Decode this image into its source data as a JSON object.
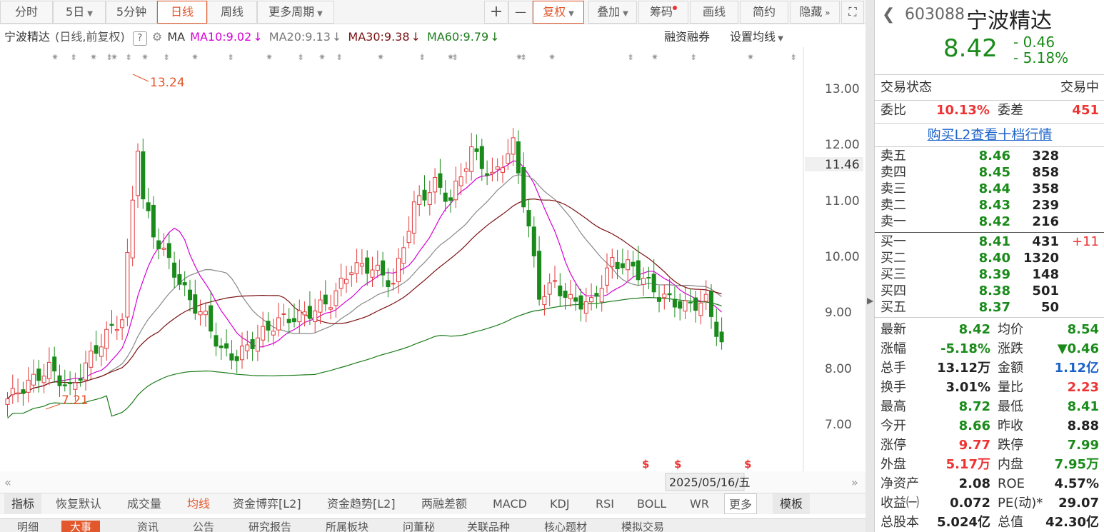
{
  "toolbar": {
    "t1": "分时",
    "t2": "5日",
    "t3": "5分钟",
    "t4": "日线",
    "t5": "周线",
    "t6": "更多周期",
    "plus": "+",
    "minus": "—",
    "fq": "复权",
    "add": "叠加",
    "chip": "筹码",
    "draw": "画线",
    "simple": "简约",
    "hide": "隐藏"
  },
  "legend": {
    "name": "宁波精达",
    "mode": "(日线,前复权)",
    "ma": "MA",
    "ma10": "MA10:9.02",
    "ma20": "MA20:9.13",
    "ma30": "MA30:9.38",
    "ma60": "MA60:9.79",
    "margin": "融资融券",
    "setma": "设置均线"
  },
  "axis": {
    "y1": "13.00",
    "y2": "12.00",
    "y3": "11.46",
    "y4": "11.00",
    "y5": "10.00",
    "y6": "9.00",
    "y7": "8.00",
    "y8": "7.00",
    "date": "2025/05/16/五",
    "hi": "13.24",
    "lo": "7.21"
  },
  "colors": {
    "up": "#e33a3a",
    "down": "#1a8b1a",
    "ma10": "#d400d4",
    "ma20": "#888888",
    "ma30": "#7a1010",
    "ma60": "#1a7a1a"
  },
  "indicators": {
    "i1": "指标",
    "i2": "恢复默认",
    "i3": "成交量",
    "i4": "均线",
    "i5": "资金博弈[L2]",
    "i6": "资金趋势[L2]",
    "i7": "两融差额",
    "i8": "MACD",
    "i9": "KDJ",
    "i10": "RSI",
    "i11": "BOLL",
    "i12": "WR",
    "i13": "更多",
    "i14": "模板"
  },
  "news": {
    "n1": "明细",
    "n2": "大事",
    "n3": "资讯",
    "n4": "公告",
    "n5": "研究报告",
    "n6": "所属板块",
    "n7": "问董秘",
    "n8": "关联品种",
    "n9": "核心题材",
    "n10": "模拟交易"
  },
  "stock": {
    "code": "603088",
    "name": "宁波精达",
    "price": "8.42",
    "chg": "- 0.46",
    "pct": "- 5.18%",
    "state_k": "交易状态",
    "state_v": "交易中",
    "wb_k": "委比",
    "wb_v": "10.13%",
    "wc_k": "委差",
    "wc_v": "451",
    "l2": "购买L2查看十档行情"
  },
  "orderbook": {
    "asks": [
      {
        "n": "卖五",
        "p": "8.46",
        "v": "328"
      },
      {
        "n": "卖四",
        "p": "8.45",
        "v": "858"
      },
      {
        "n": "卖三",
        "p": "8.44",
        "v": "358"
      },
      {
        "n": "卖二",
        "p": "8.43",
        "v": "239"
      },
      {
        "n": "卖一",
        "p": "8.42",
        "v": "216"
      }
    ],
    "bids": [
      {
        "n": "买一",
        "p": "8.41",
        "v": "431",
        "e": "+11"
      },
      {
        "n": "买二",
        "p": "8.40",
        "v": "1320",
        "e": ""
      },
      {
        "n": "买三",
        "p": "8.39",
        "v": "148",
        "e": ""
      },
      {
        "n": "买四",
        "p": "8.38",
        "v": "501",
        "e": ""
      },
      {
        "n": "买五",
        "p": "8.37",
        "v": "50",
        "e": ""
      }
    ]
  },
  "stats": [
    {
      "k1": "最新",
      "v1": "8.42",
      "c1": "g",
      "k2": "均价",
      "v2": "8.54",
      "c2": "g"
    },
    {
      "k1": "涨幅",
      "v1": "-5.18%",
      "c1": "g",
      "k2": "涨跌",
      "v2": "▼0.46",
      "c2": "g"
    },
    {
      "k1": "总手",
      "v1": "13.12万",
      "c1": "blk",
      "k2": "金额",
      "v2": "1.12亿",
      "c2": "b"
    },
    {
      "k1": "换手",
      "v1": "3.01%",
      "c1": "blk",
      "k2": "量比",
      "v2": "2.23",
      "c2": "r"
    },
    {
      "k1": "最高",
      "v1": "8.72",
      "c1": "g",
      "k2": "最低",
      "v2": "8.41",
      "c2": "g"
    },
    {
      "k1": "今开",
      "v1": "8.66",
      "c1": "g",
      "k2": "昨收",
      "v2": "8.88",
      "c2": "blk"
    },
    {
      "k1": "涨停",
      "v1": "9.77",
      "c1": "r",
      "k2": "跌停",
      "v2": "7.99",
      "c2": "g"
    },
    {
      "k1": "外盘",
      "v1": "5.17万",
      "c1": "r",
      "k2": "内盘",
      "v2": "7.95万",
      "c2": "g"
    },
    {
      "k1": "净资产",
      "v1": "2.08",
      "c1": "blk",
      "k2": "ROE",
      "v2": "4.57%",
      "c2": "blk"
    },
    {
      "k1": "收益㈠",
      "v1": "0.072",
      "c1": "blk",
      "k2": "PE(动)*",
      "v2": "29.07",
      "c2": "blk"
    },
    {
      "k1": "总股本",
      "v1": "5.024亿",
      "c1": "blk",
      "k2": "总值",
      "v2": "42.30亿",
      "c2": "blk"
    }
  ]
}
